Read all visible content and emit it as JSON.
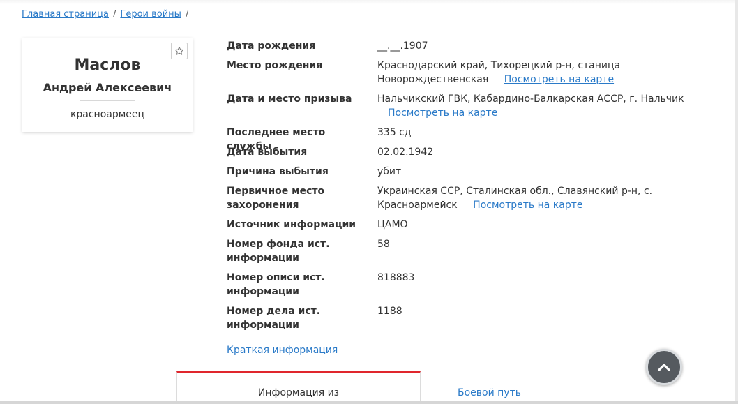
{
  "breadcrumb": {
    "home": "Главная страница",
    "section": "Герои войны",
    "separator": "/"
  },
  "person": {
    "surname": "Маслов",
    "given_names": "Андрей Алексеевич",
    "rank": "красноармеец",
    "favorite_icon": "star-outline-icon"
  },
  "map_link_label": "Посмотреть на карте",
  "details": [
    {
      "label": "Дата рождения",
      "value": "__.__.1907"
    },
    {
      "label": "Место рождения",
      "value_line1": "Краснодарский край, Тихорецкий р-н, станица",
      "value_line2": "Новорождественская",
      "has_map": true
    },
    {
      "label": "Дата и место призыва",
      "value_line1": "Нальчикский ГВК, Кабардино-Балкарская АССР, г. Нальчик",
      "has_map": true
    },
    {
      "label": "Последнее место службы",
      "value": "335 сд"
    },
    {
      "label": "Дата выбытия",
      "value": "02.02.1942"
    },
    {
      "label": "Причина выбытия",
      "value": "убит"
    },
    {
      "label_line1": "Первичное место",
      "label_line2": "захоронения",
      "value_line1": "Украинская ССР, Сталинская обл., Славянский р-н, с.",
      "value_line2": "Красноармейск",
      "has_map": true
    },
    {
      "label": "Источник информации",
      "value": "ЦАМО"
    },
    {
      "label_line1": "Номер фонда ист.",
      "label_line2": "информации",
      "value": "58"
    },
    {
      "label_line1": "Номер описи ист.",
      "label_line2": "информации",
      "value": "818883"
    },
    {
      "label_line1": "Номер дела ист.",
      "label_line2": "информации",
      "value": "1188"
    }
  ],
  "summary_link": "Краткая информация",
  "tabs": {
    "active": "Информация из",
    "other": "Боевой путь"
  },
  "scroll_top_icon": "chevron-up-icon",
  "colors": {
    "link": "#2a7ac8",
    "accent_red": "#e0262d",
    "text": "#333333",
    "scroll_button": "#555a5f"
  }
}
